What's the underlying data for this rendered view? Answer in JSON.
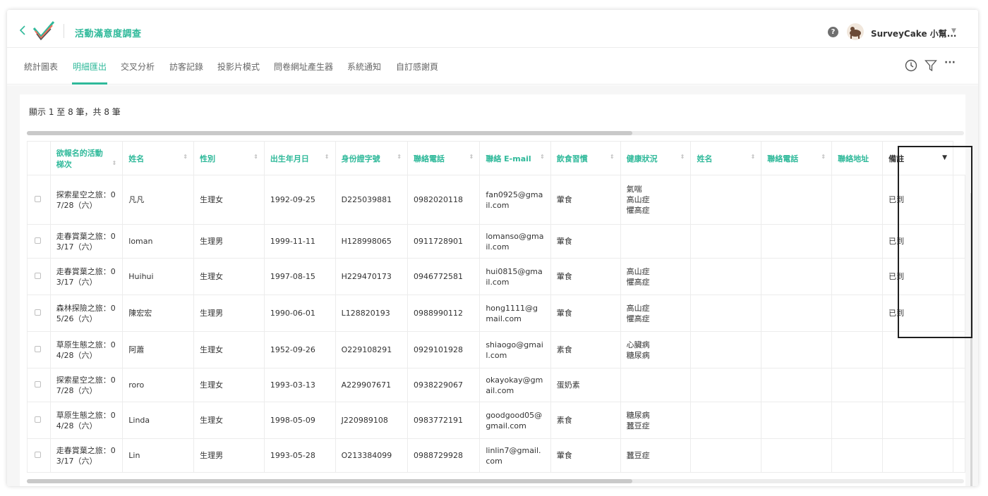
{
  "header": {
    "back_icon": "chevron-left-icon",
    "survey_title": "活動滿意度調查",
    "user_name": "SurveyCake 小幫...",
    "help_glyph": "?"
  },
  "tabs": [
    {
      "label": "統計圖表",
      "active": false
    },
    {
      "label": "明細匯出",
      "active": true
    },
    {
      "label": "交叉分析",
      "active": false
    },
    {
      "label": "訪客記錄",
      "active": false
    },
    {
      "label": "投影片模式",
      "active": false
    },
    {
      "label": "問卷網址產生器",
      "active": false
    },
    {
      "label": "系統通知",
      "active": false
    },
    {
      "label": "自訂感謝頁",
      "active": false
    }
  ],
  "toolbar": {
    "icons": [
      "clock-icon",
      "filter-icon",
      "more-icon"
    ],
    "more_glyph": "···"
  },
  "content": {
    "showing_text": "顯示 1 至 8 筆，共 8 筆"
  },
  "table": {
    "columns": [
      "欲報名的活動梯次",
      "姓名",
      "性別",
      "出生年月日",
      "身份證字號",
      "聯絡電話",
      "聯絡 E-mail",
      "飲食習慣",
      "健康狀況",
      "姓名",
      "聯絡電話",
      "聯絡地址",
      "備註"
    ],
    "rows": [
      {
        "activity": "探索星空之旅：07/28（六）",
        "name": "凡凡",
        "gender": "生理女",
        "birth": "1992-09-25",
        "id": "D225039881",
        "phone": "0982020118",
        "email": "fan0925@gmail.com",
        "diet": "葷食",
        "health": [
          "氣喘",
          "高山症",
          "懼高症"
        ],
        "name2": "",
        "phone2": "",
        "address": "",
        "note": "已到"
      },
      {
        "activity": "走春賞葉之旅：03/17（六）",
        "name": "loman",
        "gender": "生理男",
        "birth": "1999-11-11",
        "id": "H128998065",
        "phone": "0911728901",
        "email": "lomanso@gmail.com",
        "diet": "葷食",
        "health": [],
        "name2": "",
        "phone2": "",
        "address": "",
        "note": "已到"
      },
      {
        "activity": "走春賞葉之旅：03/17（六）",
        "name": "Huihui",
        "gender": "生理女",
        "birth": "1997-08-15",
        "id": "H229470173",
        "phone": "0946772581",
        "email": "hui0815@gmail.com",
        "diet": "葷食",
        "health": [
          "高山症",
          "懼高症"
        ],
        "name2": "",
        "phone2": "",
        "address": "",
        "note": "已到"
      },
      {
        "activity": "森林探險之旅：05/26（六）",
        "name": "陳宏宏",
        "gender": "生理男",
        "birth": "1990-06-01",
        "id": "L128820193",
        "phone": "0988990112",
        "email": "hong1111@gmail.com",
        "diet": "葷食",
        "health": [
          "高山症",
          "懼高症"
        ],
        "name2": "",
        "phone2": "",
        "address": "",
        "note": "已到"
      },
      {
        "activity": "草原生態之旅：04/28（六）",
        "name": "阿蕭",
        "gender": "生理女",
        "birth": "1952-09-26",
        "id": "O229108291",
        "phone": "0929101928",
        "email": "shiaogo@gmail.com",
        "diet": "素食",
        "health": [
          "心臟病",
          "糖尿病"
        ],
        "name2": "",
        "phone2": "",
        "address": "",
        "note": ""
      },
      {
        "activity": "探索星空之旅：07/28（六）",
        "name": "roro",
        "gender": "生理女",
        "birth": "1993-03-13",
        "id": "A229907671",
        "phone": "0938229067",
        "email": "okayokay@gmail.com",
        "diet": "蛋奶素",
        "health": [],
        "name2": "",
        "phone2": "",
        "address": "",
        "note": ""
      },
      {
        "activity": "草原生態之旅：04/28（六）",
        "name": "Linda",
        "gender": "生理女",
        "birth": "1998-05-09",
        "id": "J220989108",
        "phone": "0983772191",
        "email": "goodgood05@gmail.com",
        "diet": "素食",
        "health": [
          "糖尿病",
          "蠶豆症"
        ],
        "name2": "",
        "phone2": "",
        "address": "",
        "note": ""
      },
      {
        "activity": "走春賞葉之旅：03/17（六）",
        "name": "Lin",
        "gender": "生理男",
        "birth": "1993-05-28",
        "id": "O213384099",
        "phone": "0988729928",
        "email": "linlin7@gmail.com",
        "diet": "葷食",
        "health": [
          "蠶豆症"
        ],
        "name2": "",
        "phone2": "",
        "address": "",
        "note": ""
      }
    ]
  },
  "colors": {
    "accent": "#2fb99a",
    "highlight_border": "#1f1f1f"
  }
}
